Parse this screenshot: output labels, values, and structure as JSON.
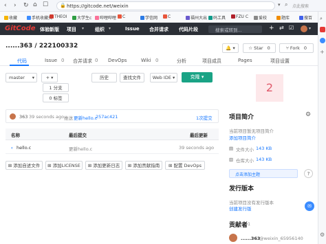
{
  "browser": {
    "url": "https://gitcode.net/weixin",
    "search_placeholder": "点此搜索"
  },
  "bookmarks": [
    {
      "label": "收藏",
      "color": "#f5b400"
    },
    {
      "label": "手机收藏夹",
      "color": "#3b8cff"
    },
    {
      "label": "THEOI",
      "color": "#d03b2f"
    },
    {
      "label": "大学生c",
      "color": "#2f9e44"
    },
    {
      "label": "哔哩哔哩",
      "color": "#fb7299"
    },
    {
      "label": "C",
      "color": "#e8553b"
    },
    {
      "label": "学信网",
      "color": "#2c7be5"
    },
    {
      "label": "C",
      "color": "#e8553b"
    },
    {
      "label": "福州大出",
      "color": "#6a5acd"
    },
    {
      "label": "码工具",
      "color": "#0e9a8a"
    },
    {
      "label": "FZU C",
      "color": "#b0202a"
    },
    {
      "label": "爱校",
      "color": "#888888"
    },
    {
      "label": "题库",
      "color": "#f08c00"
    },
    {
      "label": "搜百",
      "color": "#4263eb"
    }
  ],
  "topnav": {
    "logo": "GitCode",
    "items": [
      "体验新版",
      "项目",
      "组织",
      "Issue",
      "合并请求",
      "代码片段"
    ],
    "search_placeholder": "搜索或转到..."
  },
  "repo": {
    "name": "......363 / 222100332",
    "star_label": "Star",
    "star_count": "0",
    "fork_label": "Fork",
    "fork_count": "0"
  },
  "tabs": [
    "代码",
    "Issue",
    "合并请求",
    "DevOps",
    "Wiki",
    "分析",
    "项目成员",
    "Pages",
    "项目设置"
  ],
  "tab_counts": {
    "issue": "0",
    "mr": "0",
    "wiki": "0"
  },
  "toolbar": {
    "branch": "master",
    "plus": "+",
    "history": "历史",
    "find_file": "查找文件",
    "web_ide": "Web IDE",
    "clone": "克隆"
  },
  "stats": {
    "branch_label": "分支",
    "branch_count": "1",
    "tag_label": "标签",
    "tag_count": "0"
  },
  "commit": {
    "author": "363",
    "time": "39 seconds ago",
    "action": "推送",
    "message": "更新hello.c",
    "hash": "257ac421",
    "count": "1次提交"
  },
  "files": {
    "headers": [
      "名称",
      "最后提交",
      "最后更新"
    ],
    "rows": [
      {
        "name": "hello.c",
        "commit": "更新hello.c",
        "updated": "39 seconds ago"
      }
    ]
  },
  "actions": [
    "添加自述文件",
    "添加LICENSE",
    "添加更新日志",
    "添加贡献指南",
    "配置 DevOps"
  ],
  "sidebar": {
    "badge": "2",
    "intro_title": "项目简介",
    "intro_text": "当前项目暂无项目简介",
    "intro_link": "添加项目简介",
    "files_size_label": "文件大小",
    "files_size": "143 KB",
    "repo_size_label": "仓库大小",
    "repo_size": "143 KB",
    "topics_btn": "点击添加主题",
    "release_title": "发行版本",
    "release_text": "当前项目没有发行版本",
    "release_link": "创建发行版",
    "contributors_title": "贡献者",
    "contributor_count": "1",
    "contributor_name": "......363",
    "contributor_handle": "@weixin_65956140"
  },
  "colors": {
    "accent": "#1677ff",
    "clone": "#1aa385",
    "nav_bg": "#2b2f36",
    "logo": "#e53935",
    "badge_bg": "#fde8ea",
    "badge_text": "#e05a6b"
  }
}
